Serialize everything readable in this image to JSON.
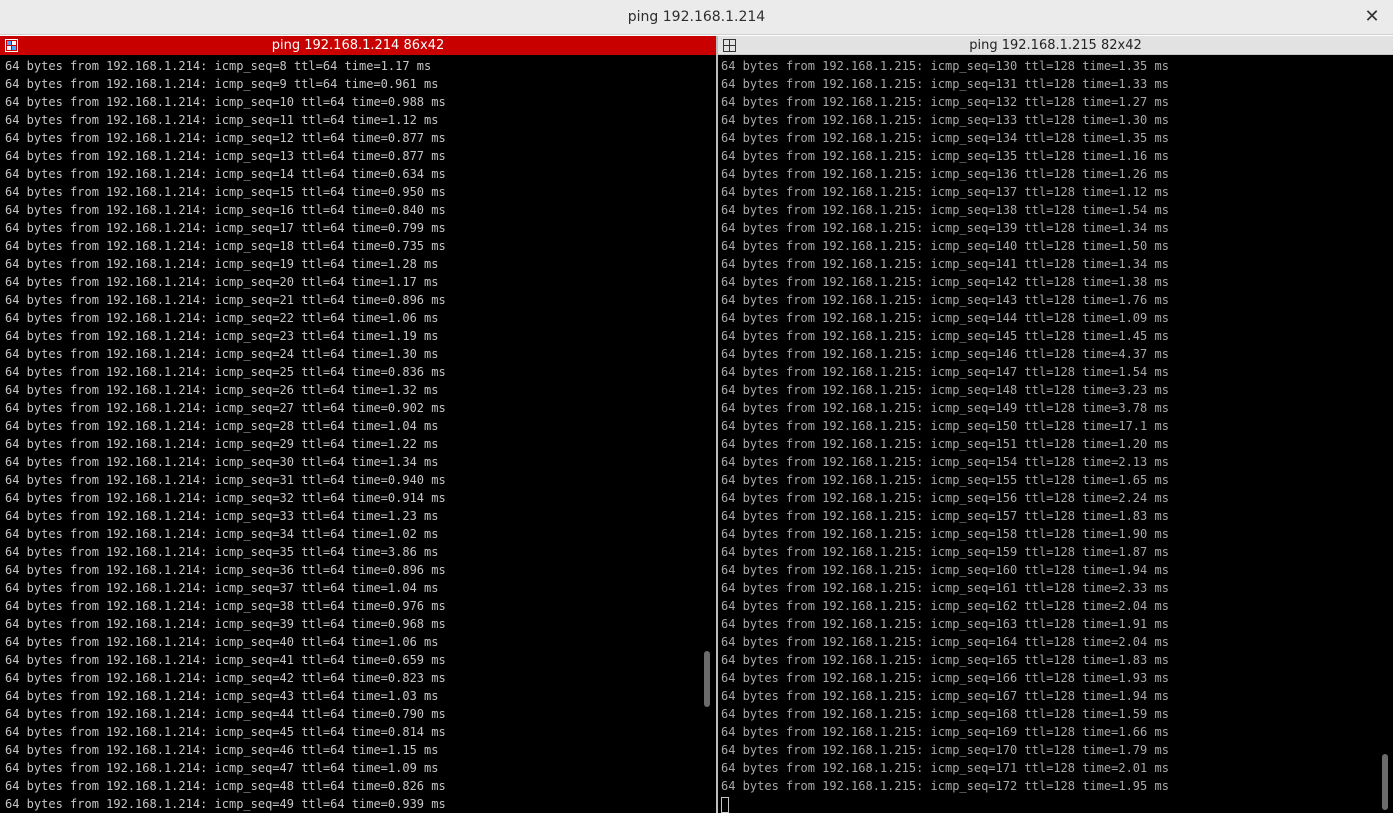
{
  "window": {
    "title": "ping 192.168.1.214",
    "close_icon": "close-icon",
    "close_glyph": "✕"
  },
  "colors": {
    "active_header": "#c80000",
    "inactive_header": "#e2e2e2",
    "terminal_bg": "#000000",
    "terminal_fg": "#c6c6c6"
  },
  "panes": [
    {
      "title": "ping 192.168.1.214 86x42",
      "icon": "split-pane-active-icon",
      "active": true,
      "lines": [
        "64 bytes from 192.168.1.214: icmp_seq=8 ttl=64 time=1.17 ms",
        "64 bytes from 192.168.1.214: icmp_seq=9 ttl=64 time=0.961 ms",
        "64 bytes from 192.168.1.214: icmp_seq=10 ttl=64 time=0.988 ms",
        "64 bytes from 192.168.1.214: icmp_seq=11 ttl=64 time=1.12 ms",
        "64 bytes from 192.168.1.214: icmp_seq=12 ttl=64 time=0.877 ms",
        "64 bytes from 192.168.1.214: icmp_seq=13 ttl=64 time=0.877 ms",
        "64 bytes from 192.168.1.214: icmp_seq=14 ttl=64 time=0.634 ms",
        "64 bytes from 192.168.1.214: icmp_seq=15 ttl=64 time=0.950 ms",
        "64 bytes from 192.168.1.214: icmp_seq=16 ttl=64 time=0.840 ms",
        "64 bytes from 192.168.1.214: icmp_seq=17 ttl=64 time=0.799 ms",
        "64 bytes from 192.168.1.214: icmp_seq=18 ttl=64 time=0.735 ms",
        "64 bytes from 192.168.1.214: icmp_seq=19 ttl=64 time=1.28 ms",
        "64 bytes from 192.168.1.214: icmp_seq=20 ttl=64 time=1.17 ms",
        "64 bytes from 192.168.1.214: icmp_seq=21 ttl=64 time=0.896 ms",
        "64 bytes from 192.168.1.214: icmp_seq=22 ttl=64 time=1.06 ms",
        "64 bytes from 192.168.1.214: icmp_seq=23 ttl=64 time=1.19 ms",
        "64 bytes from 192.168.1.214: icmp_seq=24 ttl=64 time=1.30 ms",
        "64 bytes from 192.168.1.214: icmp_seq=25 ttl=64 time=0.836 ms",
        "64 bytes from 192.168.1.214: icmp_seq=26 ttl=64 time=1.32 ms",
        "64 bytes from 192.168.1.214: icmp_seq=27 ttl=64 time=0.902 ms",
        "64 bytes from 192.168.1.214: icmp_seq=28 ttl=64 time=1.04 ms",
        "64 bytes from 192.168.1.214: icmp_seq=29 ttl=64 time=1.22 ms",
        "64 bytes from 192.168.1.214: icmp_seq=30 ttl=64 time=1.34 ms",
        "64 bytes from 192.168.1.214: icmp_seq=31 ttl=64 time=0.940 ms",
        "64 bytes from 192.168.1.214: icmp_seq=32 ttl=64 time=0.914 ms",
        "64 bytes from 192.168.1.214: icmp_seq=33 ttl=64 time=1.23 ms",
        "64 bytes from 192.168.1.214: icmp_seq=34 ttl=64 time=1.02 ms",
        "64 bytes from 192.168.1.214: icmp_seq=35 ttl=64 time=3.86 ms",
        "64 bytes from 192.168.1.214: icmp_seq=36 ttl=64 time=0.896 ms",
        "64 bytes from 192.168.1.214: icmp_seq=37 ttl=64 time=1.04 ms",
        "64 bytes from 192.168.1.214: icmp_seq=38 ttl=64 time=0.976 ms",
        "64 bytes from 192.168.1.214: icmp_seq=39 ttl=64 time=0.968 ms",
        "64 bytes from 192.168.1.214: icmp_seq=40 ttl=64 time=1.06 ms",
        "64 bytes from 192.168.1.214: icmp_seq=41 ttl=64 time=0.659 ms",
        "64 bytes from 192.168.1.214: icmp_seq=42 ttl=64 time=0.823 ms",
        "64 bytes from 192.168.1.214: icmp_seq=43 ttl=64 time=1.03 ms",
        "64 bytes from 192.168.1.214: icmp_seq=44 ttl=64 time=0.790 ms",
        "64 bytes from 192.168.1.214: icmp_seq=45 ttl=64 time=0.814 ms",
        "64 bytes from 192.168.1.214: icmp_seq=46 ttl=64 time=1.15 ms",
        "64 bytes from 192.168.1.214: icmp_seq=47 ttl=64 time=1.09 ms",
        "64 bytes from 192.168.1.214: icmp_seq=48 ttl=64 time=0.826 ms",
        "64 bytes from 192.168.1.214: icmp_seq=49 ttl=64 time=0.939 ms"
      ]
    },
    {
      "title": "ping 192.168.1.215 82x42",
      "icon": "split-pane-icon",
      "active": false,
      "lines": [
        "64 bytes from 192.168.1.215: icmp_seq=130 ttl=128 time=1.35 ms",
        "64 bytes from 192.168.1.215: icmp_seq=131 ttl=128 time=1.33 ms",
        "64 bytes from 192.168.1.215: icmp_seq=132 ttl=128 time=1.27 ms",
        "64 bytes from 192.168.1.215: icmp_seq=133 ttl=128 time=1.30 ms",
        "64 bytes from 192.168.1.215: icmp_seq=134 ttl=128 time=1.35 ms",
        "64 bytes from 192.168.1.215: icmp_seq=135 ttl=128 time=1.16 ms",
        "64 bytes from 192.168.1.215: icmp_seq=136 ttl=128 time=1.26 ms",
        "64 bytes from 192.168.1.215: icmp_seq=137 ttl=128 time=1.12 ms",
        "64 bytes from 192.168.1.215: icmp_seq=138 ttl=128 time=1.54 ms",
        "64 bytes from 192.168.1.215: icmp_seq=139 ttl=128 time=1.34 ms",
        "64 bytes from 192.168.1.215: icmp_seq=140 ttl=128 time=1.50 ms",
        "64 bytes from 192.168.1.215: icmp_seq=141 ttl=128 time=1.34 ms",
        "64 bytes from 192.168.1.215: icmp_seq=142 ttl=128 time=1.38 ms",
        "64 bytes from 192.168.1.215: icmp_seq=143 ttl=128 time=1.76 ms",
        "64 bytes from 192.168.1.215: icmp_seq=144 ttl=128 time=1.09 ms",
        "64 bytes from 192.168.1.215: icmp_seq=145 ttl=128 time=1.45 ms",
        "64 bytes from 192.168.1.215: icmp_seq=146 ttl=128 time=4.37 ms",
        "64 bytes from 192.168.1.215: icmp_seq=147 ttl=128 time=1.54 ms",
        "64 bytes from 192.168.1.215: icmp_seq=148 ttl=128 time=3.23 ms",
        "64 bytes from 192.168.1.215: icmp_seq=149 ttl=128 time=3.78 ms",
        "64 bytes from 192.168.1.215: icmp_seq=150 ttl=128 time=17.1 ms",
        "64 bytes from 192.168.1.215: icmp_seq=151 ttl=128 time=1.20 ms",
        "64 bytes from 192.168.1.215: icmp_seq=154 ttl=128 time=2.13 ms",
        "64 bytes from 192.168.1.215: icmp_seq=155 ttl=128 time=1.65 ms",
        "64 bytes from 192.168.1.215: icmp_seq=156 ttl=128 time=2.24 ms",
        "64 bytes from 192.168.1.215: icmp_seq=157 ttl=128 time=1.83 ms",
        "64 bytes from 192.168.1.215: icmp_seq=158 ttl=128 time=1.90 ms",
        "64 bytes from 192.168.1.215: icmp_seq=159 ttl=128 time=1.87 ms",
        "64 bytes from 192.168.1.215: icmp_seq=160 ttl=128 time=1.94 ms",
        "64 bytes from 192.168.1.215: icmp_seq=161 ttl=128 time=2.33 ms",
        "64 bytes from 192.168.1.215: icmp_seq=162 ttl=128 time=2.04 ms",
        "64 bytes from 192.168.1.215: icmp_seq=163 ttl=128 time=1.91 ms",
        "64 bytes from 192.168.1.215: icmp_seq=164 ttl=128 time=2.04 ms",
        "64 bytes from 192.168.1.215: icmp_seq=165 ttl=128 time=1.83 ms",
        "64 bytes from 192.168.1.215: icmp_seq=166 ttl=128 time=1.93 ms",
        "64 bytes from 192.168.1.215: icmp_seq=167 ttl=128 time=1.94 ms",
        "64 bytes from 192.168.1.215: icmp_seq=168 ttl=128 time=1.59 ms",
        "64 bytes from 192.168.1.215: icmp_seq=169 ttl=128 time=1.66 ms",
        "64 bytes from 192.168.1.215: icmp_seq=170 ttl=128 time=1.79 ms",
        "64 bytes from 192.168.1.215: icmp_seq=171 ttl=128 time=2.01 ms",
        "64 bytes from 192.168.1.215: icmp_seq=172 ttl=128 time=1.95 ms"
      ],
      "has_cursor": true
    }
  ]
}
